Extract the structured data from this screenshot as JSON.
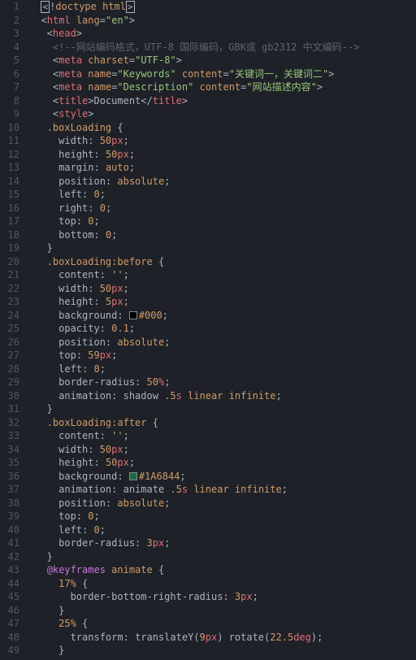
{
  "lines": [
    {
      "n": 1,
      "segs": [
        {
          "t": "  ",
          "c": "punc"
        },
        {
          "t": "<",
          "c": "punc",
          "box": true
        },
        {
          "t": "!",
          "c": "punc"
        },
        {
          "t": "doctype html",
          "c": "attr"
        },
        {
          "t": ">",
          "c": "punc",
          "box": true
        }
      ]
    },
    {
      "n": 2,
      "segs": [
        {
          "t": "  ",
          "c": "punc"
        },
        {
          "t": "<",
          "c": "punc"
        },
        {
          "t": "html",
          "c": "tag"
        },
        {
          "t": " ",
          "c": "punc"
        },
        {
          "t": "lang",
          "c": "attr"
        },
        {
          "t": "=",
          "c": "punc"
        },
        {
          "t": "\"en\"",
          "c": "str"
        },
        {
          "t": ">",
          "c": "punc"
        }
      ]
    },
    {
      "n": 3,
      "segs": [
        {
          "t": "   ",
          "c": "punc"
        },
        {
          "t": "<",
          "c": "punc"
        },
        {
          "t": "head",
          "c": "tag"
        },
        {
          "t": ">",
          "c": "punc"
        }
      ]
    },
    {
      "n": 4,
      "segs": [
        {
          "t": "    ",
          "c": "punc"
        },
        {
          "t": "<!--网站编码格式，UTF-8 国际编码，GBK或 gb2312 中文编码-->",
          "c": "cmt"
        }
      ]
    },
    {
      "n": 5,
      "segs": [
        {
          "t": "    ",
          "c": "punc"
        },
        {
          "t": "<",
          "c": "punc"
        },
        {
          "t": "meta",
          "c": "tag"
        },
        {
          "t": " ",
          "c": "punc"
        },
        {
          "t": "charset",
          "c": "attr"
        },
        {
          "t": "=",
          "c": "punc"
        },
        {
          "t": "\"UTF-8\"",
          "c": "str"
        },
        {
          "t": ">",
          "c": "punc"
        }
      ]
    },
    {
      "n": 6,
      "segs": [
        {
          "t": "    ",
          "c": "punc"
        },
        {
          "t": "<",
          "c": "punc"
        },
        {
          "t": "meta",
          "c": "tag"
        },
        {
          "t": " ",
          "c": "punc"
        },
        {
          "t": "name",
          "c": "attr"
        },
        {
          "t": "=",
          "c": "punc"
        },
        {
          "t": "\"Keywords\"",
          "c": "str"
        },
        {
          "t": " ",
          "c": "punc"
        },
        {
          "t": "content",
          "c": "attr"
        },
        {
          "t": "=",
          "c": "punc"
        },
        {
          "t": "\"关键词一，关键词二\"",
          "c": "str"
        },
        {
          "t": ">",
          "c": "punc"
        }
      ]
    },
    {
      "n": 7,
      "segs": [
        {
          "t": "    ",
          "c": "punc"
        },
        {
          "t": "<",
          "c": "punc"
        },
        {
          "t": "meta",
          "c": "tag"
        },
        {
          "t": " ",
          "c": "punc"
        },
        {
          "t": "name",
          "c": "attr"
        },
        {
          "t": "=",
          "c": "punc"
        },
        {
          "t": "\"Description\"",
          "c": "str"
        },
        {
          "t": " ",
          "c": "punc"
        },
        {
          "t": "content",
          "c": "attr"
        },
        {
          "t": "=",
          "c": "punc"
        },
        {
          "t": "\"网站描述内容\"",
          "c": "str"
        },
        {
          "t": ">",
          "c": "punc"
        }
      ]
    },
    {
      "n": 8,
      "segs": [
        {
          "t": "    ",
          "c": "punc"
        },
        {
          "t": "<",
          "c": "punc"
        },
        {
          "t": "title",
          "c": "tag"
        },
        {
          "t": ">",
          "c": "punc"
        },
        {
          "t": "Document",
          "c": "punc"
        },
        {
          "t": "</",
          "c": "punc"
        },
        {
          "t": "title",
          "c": "tag"
        },
        {
          "t": ">",
          "c": "punc"
        }
      ]
    },
    {
      "n": 9,
      "segs": [
        {
          "t": "    ",
          "c": "punc"
        },
        {
          "t": "<",
          "c": "punc"
        },
        {
          "t": "style",
          "c": "tag"
        },
        {
          "t": ">",
          "c": "punc"
        }
      ]
    },
    {
      "n": 10,
      "segs": [
        {
          "t": "   ",
          "c": "punc"
        },
        {
          "t": ".boxLoading",
          "c": "sel"
        },
        {
          "t": " {",
          "c": "punc"
        }
      ]
    },
    {
      "n": 11,
      "segs": [
        {
          "t": "     ",
          "c": "punc"
        },
        {
          "t": "width",
          "c": "prop"
        },
        {
          "t": ": ",
          "c": "punc"
        },
        {
          "t": "50",
          "c": "num"
        },
        {
          "t": "px",
          "c": "unit"
        },
        {
          "t": ";",
          "c": "punc"
        }
      ]
    },
    {
      "n": 12,
      "segs": [
        {
          "t": "     ",
          "c": "punc"
        },
        {
          "t": "height",
          "c": "prop"
        },
        {
          "t": ": ",
          "c": "punc"
        },
        {
          "t": "50",
          "c": "num"
        },
        {
          "t": "px",
          "c": "unit"
        },
        {
          "t": ";",
          "c": "punc"
        }
      ]
    },
    {
      "n": 13,
      "segs": [
        {
          "t": "     ",
          "c": "punc"
        },
        {
          "t": "margin",
          "c": "prop"
        },
        {
          "t": ": ",
          "c": "punc"
        },
        {
          "t": "auto",
          "c": "val"
        },
        {
          "t": ";",
          "c": "punc"
        }
      ]
    },
    {
      "n": 14,
      "segs": [
        {
          "t": "     ",
          "c": "punc"
        },
        {
          "t": "position",
          "c": "prop"
        },
        {
          "t": ": ",
          "c": "punc"
        },
        {
          "t": "absolute",
          "c": "val"
        },
        {
          "t": ";",
          "c": "punc"
        }
      ]
    },
    {
      "n": 15,
      "segs": [
        {
          "t": "     ",
          "c": "punc"
        },
        {
          "t": "left",
          "c": "prop"
        },
        {
          "t": ": ",
          "c": "punc"
        },
        {
          "t": "0",
          "c": "num"
        },
        {
          "t": ";",
          "c": "punc"
        }
      ]
    },
    {
      "n": 16,
      "segs": [
        {
          "t": "     ",
          "c": "punc"
        },
        {
          "t": "right",
          "c": "prop"
        },
        {
          "t": ": ",
          "c": "punc"
        },
        {
          "t": "0",
          "c": "num"
        },
        {
          "t": ";",
          "c": "punc"
        }
      ]
    },
    {
      "n": 17,
      "segs": [
        {
          "t": "     ",
          "c": "punc"
        },
        {
          "t": "top",
          "c": "prop"
        },
        {
          "t": ": ",
          "c": "punc"
        },
        {
          "t": "0",
          "c": "num"
        },
        {
          "t": ";",
          "c": "punc"
        }
      ]
    },
    {
      "n": 18,
      "segs": [
        {
          "t": "     ",
          "c": "punc"
        },
        {
          "t": "bottom",
          "c": "prop"
        },
        {
          "t": ": ",
          "c": "punc"
        },
        {
          "t": "0",
          "c": "num"
        },
        {
          "t": ";",
          "c": "punc"
        }
      ]
    },
    {
      "n": 19,
      "segs": [
        {
          "t": "   }",
          "c": "punc"
        }
      ]
    },
    {
      "n": 20,
      "segs": [
        {
          "t": "   ",
          "c": "punc"
        },
        {
          "t": ".boxLoading:before",
          "c": "sel"
        },
        {
          "t": " {",
          "c": "punc"
        }
      ]
    },
    {
      "n": 21,
      "segs": [
        {
          "t": "     ",
          "c": "punc"
        },
        {
          "t": "content",
          "c": "prop"
        },
        {
          "t": ": ",
          "c": "punc"
        },
        {
          "t": "''",
          "c": "str"
        },
        {
          "t": ";",
          "c": "punc"
        }
      ]
    },
    {
      "n": 22,
      "segs": [
        {
          "t": "     ",
          "c": "punc"
        },
        {
          "t": "width",
          "c": "prop"
        },
        {
          "t": ": ",
          "c": "punc"
        },
        {
          "t": "50",
          "c": "num"
        },
        {
          "t": "px",
          "c": "unit"
        },
        {
          "t": ";",
          "c": "punc"
        }
      ]
    },
    {
      "n": 23,
      "segs": [
        {
          "t": "     ",
          "c": "punc"
        },
        {
          "t": "height",
          "c": "prop"
        },
        {
          "t": ": ",
          "c": "punc"
        },
        {
          "t": "5",
          "c": "num"
        },
        {
          "t": "px",
          "c": "unit"
        },
        {
          "t": ";",
          "c": "punc"
        }
      ]
    },
    {
      "n": 24,
      "segs": [
        {
          "t": "     ",
          "c": "punc"
        },
        {
          "t": "background",
          "c": "prop"
        },
        {
          "t": ": ",
          "c": "punc"
        },
        {
          "t": "",
          "swatch": "#000"
        },
        {
          "t": "#000",
          "c": "val"
        },
        {
          "t": ";",
          "c": "punc"
        }
      ]
    },
    {
      "n": 25,
      "segs": [
        {
          "t": "     ",
          "c": "punc"
        },
        {
          "t": "opacity",
          "c": "prop"
        },
        {
          "t": ": ",
          "c": "punc"
        },
        {
          "t": "0.1",
          "c": "num"
        },
        {
          "t": ";",
          "c": "punc"
        }
      ]
    },
    {
      "n": 26,
      "segs": [
        {
          "t": "     ",
          "c": "punc"
        },
        {
          "t": "position",
          "c": "prop"
        },
        {
          "t": ": ",
          "c": "punc"
        },
        {
          "t": "absolute",
          "c": "val"
        },
        {
          "t": ";",
          "c": "punc"
        }
      ]
    },
    {
      "n": 27,
      "segs": [
        {
          "t": "     ",
          "c": "punc"
        },
        {
          "t": "top",
          "c": "prop"
        },
        {
          "t": ": ",
          "c": "punc"
        },
        {
          "t": "59",
          "c": "num"
        },
        {
          "t": "px",
          "c": "unit"
        },
        {
          "t": ";",
          "c": "punc"
        }
      ]
    },
    {
      "n": 28,
      "segs": [
        {
          "t": "     ",
          "c": "punc"
        },
        {
          "t": "left",
          "c": "prop"
        },
        {
          "t": ": ",
          "c": "punc"
        },
        {
          "t": "0",
          "c": "num"
        },
        {
          "t": ";",
          "c": "punc"
        }
      ]
    },
    {
      "n": 29,
      "segs": [
        {
          "t": "     ",
          "c": "punc"
        },
        {
          "t": "border-radius",
          "c": "prop"
        },
        {
          "t": ": ",
          "c": "punc"
        },
        {
          "t": "50",
          "c": "num"
        },
        {
          "t": "%",
          "c": "unit"
        },
        {
          "t": ";",
          "c": "punc"
        }
      ]
    },
    {
      "n": 30,
      "segs": [
        {
          "t": "     ",
          "c": "punc"
        },
        {
          "t": "animation",
          "c": "prop"
        },
        {
          "t": ": ",
          "c": "punc"
        },
        {
          "t": "shadow ",
          "c": "punc"
        },
        {
          "t": ".5",
          "c": "num"
        },
        {
          "t": "s",
          "c": "unit"
        },
        {
          "t": " ",
          "c": "punc"
        },
        {
          "t": "linear",
          "c": "val"
        },
        {
          "t": " ",
          "c": "punc"
        },
        {
          "t": "infinite",
          "c": "val"
        },
        {
          "t": ";",
          "c": "punc"
        }
      ]
    },
    {
      "n": 31,
      "segs": [
        {
          "t": "   }",
          "c": "punc"
        }
      ]
    },
    {
      "n": 32,
      "segs": [
        {
          "t": "   ",
          "c": "punc"
        },
        {
          "t": ".boxLoading:after",
          "c": "sel"
        },
        {
          "t": " {",
          "c": "punc"
        }
      ]
    },
    {
      "n": 33,
      "segs": [
        {
          "t": "     ",
          "c": "punc"
        },
        {
          "t": "content",
          "c": "prop"
        },
        {
          "t": ": ",
          "c": "punc"
        },
        {
          "t": "''",
          "c": "str"
        },
        {
          "t": ";",
          "c": "punc"
        }
      ]
    },
    {
      "n": 34,
      "segs": [
        {
          "t": "     ",
          "c": "punc"
        },
        {
          "t": "width",
          "c": "prop"
        },
        {
          "t": ": ",
          "c": "punc"
        },
        {
          "t": "50",
          "c": "num"
        },
        {
          "t": "px",
          "c": "unit"
        },
        {
          "t": ";",
          "c": "punc"
        }
      ]
    },
    {
      "n": 35,
      "segs": [
        {
          "t": "     ",
          "c": "punc"
        },
        {
          "t": "height",
          "c": "prop"
        },
        {
          "t": ": ",
          "c": "punc"
        },
        {
          "t": "50",
          "c": "num"
        },
        {
          "t": "px",
          "c": "unit"
        },
        {
          "t": ";",
          "c": "punc"
        }
      ]
    },
    {
      "n": 36,
      "segs": [
        {
          "t": "     ",
          "c": "punc"
        },
        {
          "t": "background",
          "c": "prop"
        },
        {
          "t": ": ",
          "c": "punc"
        },
        {
          "t": "",
          "swatch": "#1A6844"
        },
        {
          "t": "#1A6844",
          "c": "val"
        },
        {
          "t": ";",
          "c": "punc"
        }
      ]
    },
    {
      "n": 37,
      "segs": [
        {
          "t": "     ",
          "c": "punc"
        },
        {
          "t": "animation",
          "c": "prop"
        },
        {
          "t": ": ",
          "c": "punc"
        },
        {
          "t": "animate ",
          "c": "punc"
        },
        {
          "t": ".5",
          "c": "num"
        },
        {
          "t": "s",
          "c": "unit"
        },
        {
          "t": " ",
          "c": "punc"
        },
        {
          "t": "linear",
          "c": "val"
        },
        {
          "t": " ",
          "c": "punc"
        },
        {
          "t": "infinite",
          "c": "val"
        },
        {
          "t": ";",
          "c": "punc"
        }
      ]
    },
    {
      "n": 38,
      "segs": [
        {
          "t": "     ",
          "c": "punc"
        },
        {
          "t": "position",
          "c": "prop"
        },
        {
          "t": ": ",
          "c": "punc"
        },
        {
          "t": "absolute",
          "c": "val"
        },
        {
          "t": ";",
          "c": "punc"
        }
      ]
    },
    {
      "n": 39,
      "segs": [
        {
          "t": "     ",
          "c": "punc"
        },
        {
          "t": "top",
          "c": "prop"
        },
        {
          "t": ": ",
          "c": "punc"
        },
        {
          "t": "0",
          "c": "num"
        },
        {
          "t": ";",
          "c": "punc"
        }
      ]
    },
    {
      "n": 40,
      "segs": [
        {
          "t": "     ",
          "c": "punc"
        },
        {
          "t": "left",
          "c": "prop"
        },
        {
          "t": ": ",
          "c": "punc"
        },
        {
          "t": "0",
          "c": "num"
        },
        {
          "t": ";",
          "c": "punc"
        }
      ]
    },
    {
      "n": 41,
      "segs": [
        {
          "t": "     ",
          "c": "punc"
        },
        {
          "t": "border-radius",
          "c": "prop"
        },
        {
          "t": ": ",
          "c": "punc"
        },
        {
          "t": "3",
          "c": "num"
        },
        {
          "t": "px",
          "c": "unit"
        },
        {
          "t": ";",
          "c": "punc"
        }
      ]
    },
    {
      "n": 42,
      "segs": [
        {
          "t": "   }",
          "c": "punc"
        }
      ]
    },
    {
      "n": 43,
      "segs": [
        {
          "t": "   ",
          "c": "punc"
        },
        {
          "t": "@keyframes",
          "c": "kw"
        },
        {
          "t": " ",
          "c": "punc"
        },
        {
          "t": "animate",
          "c": "sel"
        },
        {
          "t": " {",
          "c": "punc"
        }
      ]
    },
    {
      "n": 44,
      "segs": [
        {
          "t": "     ",
          "c": "punc"
        },
        {
          "t": "17%",
          "c": "sel"
        },
        {
          "t": " {",
          "c": "punc"
        }
      ]
    },
    {
      "n": 45,
      "segs": [
        {
          "t": "       ",
          "c": "punc"
        },
        {
          "t": "border-bottom-right-radius",
          "c": "prop"
        },
        {
          "t": ": ",
          "c": "punc"
        },
        {
          "t": "3",
          "c": "num"
        },
        {
          "t": "px",
          "c": "unit"
        },
        {
          "t": ";",
          "c": "punc"
        }
      ]
    },
    {
      "n": 46,
      "segs": [
        {
          "t": "     }",
          "c": "punc"
        }
      ]
    },
    {
      "n": 47,
      "segs": [
        {
          "t": "     ",
          "c": "punc"
        },
        {
          "t": "25%",
          "c": "sel"
        },
        {
          "t": " {",
          "c": "punc"
        }
      ]
    },
    {
      "n": 48,
      "segs": [
        {
          "t": "       ",
          "c": "punc"
        },
        {
          "t": "transform",
          "c": "prop"
        },
        {
          "t": ": ",
          "c": "punc"
        },
        {
          "t": "translateY",
          "c": "punc"
        },
        {
          "t": "(",
          "c": "punc"
        },
        {
          "t": "9",
          "c": "num"
        },
        {
          "t": "px",
          "c": "unit"
        },
        {
          "t": ") ",
          "c": "punc"
        },
        {
          "t": "rotate",
          "c": "punc"
        },
        {
          "t": "(",
          "c": "punc"
        },
        {
          "t": "22.5",
          "c": "num"
        },
        {
          "t": "deg",
          "c": "unit"
        },
        {
          "t": ");",
          "c": "punc"
        }
      ]
    },
    {
      "n": 49,
      "segs": [
        {
          "t": "     }",
          "c": "punc"
        }
      ]
    }
  ]
}
